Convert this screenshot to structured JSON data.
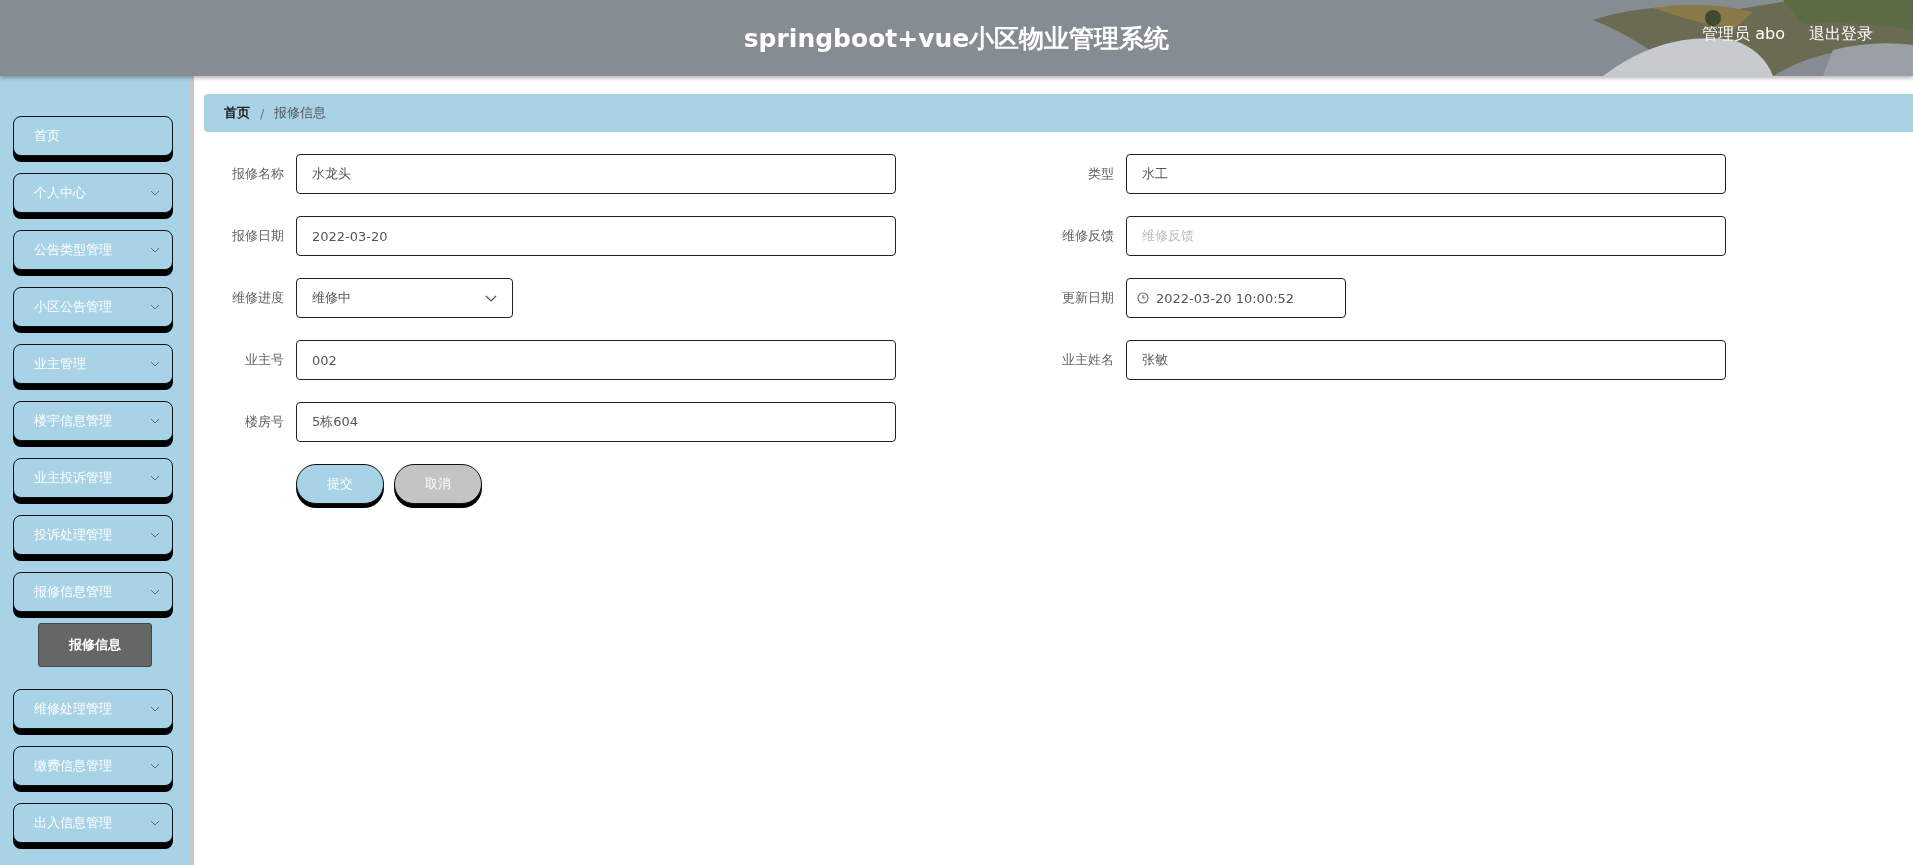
{
  "header": {
    "title": "springboot+vue小区物业管理系统",
    "user": "管理员 abo",
    "logout": "退出登录"
  },
  "sidebar": {
    "items": [
      {
        "label": "首页",
        "kind": "link"
      },
      {
        "label": "个人中心",
        "kind": "menu"
      },
      {
        "label": "公告类型管理",
        "kind": "menu"
      },
      {
        "label": "小区公告管理",
        "kind": "menu"
      },
      {
        "label": "业主管理",
        "kind": "menu"
      },
      {
        "label": "楼宇信息管理",
        "kind": "menu"
      },
      {
        "label": "业主投诉管理",
        "kind": "menu"
      },
      {
        "label": "投诉处理管理",
        "kind": "menu"
      },
      {
        "label": "报修信息管理",
        "kind": "menu",
        "children": [
          {
            "label": "报修信息",
            "selected": true
          }
        ]
      },
      {
        "label": "维修处理管理",
        "kind": "menu"
      },
      {
        "label": "缴费信息管理",
        "kind": "menu"
      },
      {
        "label": "出入信息管理",
        "kind": "menu"
      }
    ]
  },
  "breadcrumb": {
    "separator": "/",
    "items": [
      {
        "label": "首页"
      },
      {
        "label": "报修信息"
      }
    ]
  },
  "form": {
    "left": [
      {
        "label": "报修名称",
        "kind": "text",
        "value": "水龙头"
      },
      {
        "label": "报修日期",
        "kind": "text",
        "value": "2022-03-20"
      },
      {
        "label": "维修进度",
        "kind": "select",
        "value": "维修中"
      },
      {
        "label": "业主号",
        "kind": "text",
        "value": "002"
      },
      {
        "label": "楼房号",
        "kind": "text",
        "value": "5栋604"
      }
    ],
    "right": [
      {
        "label": "类型",
        "kind": "text",
        "value": "水工"
      },
      {
        "label": "维修反馈",
        "kind": "text",
        "placeholder": "维修反馈"
      },
      {
        "label": "更新日期",
        "kind": "datetime",
        "value": "2022-03-20 10:00:52"
      },
      {
        "label": "业主姓名",
        "kind": "text",
        "value": "张敏"
      }
    ],
    "buttons": [
      {
        "label": "提交",
        "kind": "primary"
      },
      {
        "label": "取消",
        "kind": "cancel"
      }
    ]
  }
}
